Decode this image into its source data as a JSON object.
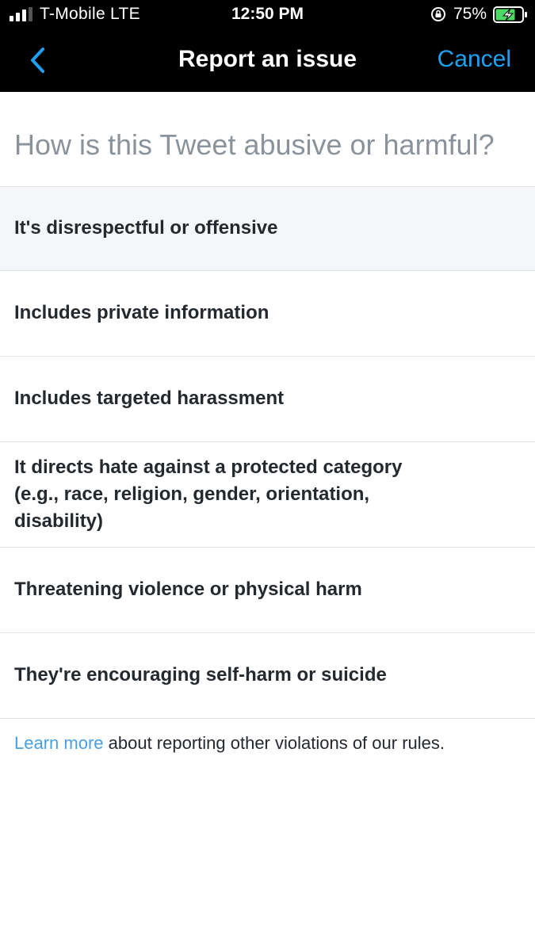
{
  "status_bar": {
    "carrier": "T-Mobile  LTE",
    "time": "12:50 PM",
    "battery_percent": "75%",
    "signal_bars": 3,
    "battery_level": 0.75
  },
  "nav": {
    "back_icon": "chevron-left-icon",
    "title": "Report an issue",
    "cancel_label": "Cancel"
  },
  "question": "How is this Tweet abusive or harmful?",
  "options": [
    {
      "label": "It's disrespectful or offensive"
    },
    {
      "label": "Includes private information"
    },
    {
      "label": "Includes targeted harassment"
    },
    {
      "label": "It directs hate against a protected category (e.g., race, religion, gender, orientation, disability)"
    },
    {
      "label": "Threatening violence or physical harm"
    },
    {
      "label": "They're encouraging self-harm or suicide"
    }
  ],
  "footer": {
    "link_text": "Learn more",
    "text": " about reporting other violations of our rules."
  },
  "colors": {
    "accent": "#1da1f2",
    "link": "#4a9fe0",
    "header_bg": "#000000",
    "battery_charging": "#4cd964",
    "question_text": "#8a939c",
    "selected_row": "#f5f6f7"
  }
}
